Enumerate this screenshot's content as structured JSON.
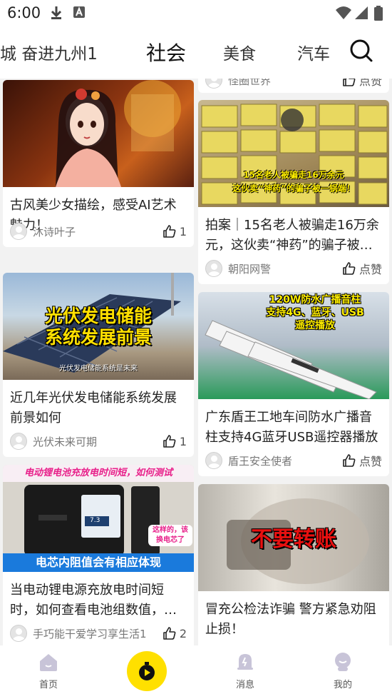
{
  "status_bar": {
    "time": "6:00"
  },
  "top_nav": {
    "tabs": [
      "城 奋进九州1",
      "社会",
      "美食",
      "汽车"
    ],
    "active_tab": "社会"
  },
  "feed": {
    "left": [
      {
        "title": "古风美少女描绘，感受AI艺术魅力！",
        "author": "沐诗叶子",
        "likes": "1"
      },
      {
        "title": "近几年光伏发电储能系统发展前景如何",
        "author": "光伏未来可期",
        "likes": "1",
        "thumb_text": [
          "光伏发电储能",
          "系统发展前景"
        ],
        "thumb_caption": "光伏发电储能系统是未来"
      },
      {
        "title": "当电动锂电源充放电时间短时，如何查看电池组数值，…",
        "author": "手巧能干爱学习享生活1",
        "likes": "2",
        "thumb_top": "电动锂电池充放电时间短，如何测试",
        "thumb_bottom": "电芯内阻值会有相应体现",
        "thumb_bubble": "这样的，该换电芯了",
        "thumb_reading": "7.3"
      }
    ],
    "right": [
      {
        "author": "怪圈世界",
        "likes": "点赞"
      },
      {
        "title": "拍案｜15名老人被骗走16万余元，这伙卖“神药”的骗子被…",
        "author": "朝阳网警",
        "likes": "点赞",
        "thumb_text": [
          "15名老人被骗走16万余元",
          "这伙卖“神药”的骗子被一锅端！"
        ]
      },
      {
        "title": "广东盾王工地车间防水广播音柱支持4G蓝牙USB遥控器播放",
        "author": "盾王安全使者",
        "likes": "点赞",
        "thumb_text": [
          "120W防水广播音柱",
          "支持4G、蓝牙、USB",
          "遥控播放"
        ]
      },
      {
        "title": "冒充公检法诈骗 警方紧急劝阻止损！",
        "thumb_text": "不要转账"
      }
    ]
  },
  "bottom_nav": {
    "home": "首页",
    "messages": "消息",
    "mine": "我的"
  },
  "colors": {
    "accent": "#ffe000",
    "background": "#f2f2f2",
    "text": "#222222"
  }
}
